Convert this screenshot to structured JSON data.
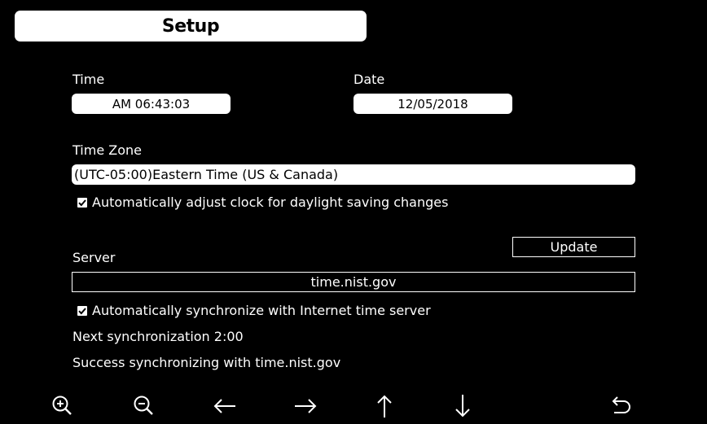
{
  "header": {
    "title": "Setup"
  },
  "time": {
    "label": "Time",
    "value": "AM 06:43:03"
  },
  "date": {
    "label": "Date",
    "value": "12/05/2018"
  },
  "timezone": {
    "label": "Time Zone",
    "value": "(UTC-05:00)Eastern Time (US & Canada)",
    "dst_checkbox_label": "Automatically adjust clock for daylight saving changes",
    "dst_checked": true
  },
  "server": {
    "label": "Server",
    "update_label": "Update",
    "value": "time.nist.gov",
    "sync_checkbox_label": "Automatically synchronize with Internet time server",
    "sync_checked": true,
    "next_sync": "Next synchronization 2:00",
    "status": "Success synchronizing with time.nist.gov"
  },
  "toolbar": {
    "icons": [
      "zoom-in-icon",
      "zoom-out-icon",
      "arrow-left-icon",
      "arrow-right-icon",
      "arrow-up-icon",
      "arrow-down-icon",
      "back-icon"
    ]
  },
  "colors": {
    "background": "#000000",
    "foreground": "#ffffff"
  }
}
